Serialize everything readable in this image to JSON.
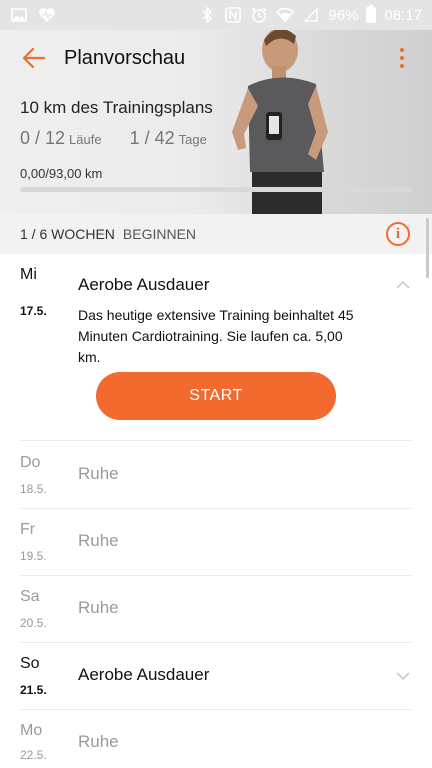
{
  "statusbar": {
    "battery_percent": "96%",
    "time": "08:17",
    "icons": [
      "image-icon",
      "heart-monitor-icon",
      "bluetooth-icon",
      "nfc-icon",
      "alarm-icon",
      "wifi-icon",
      "signal-icon",
      "battery-icon"
    ]
  },
  "header": {
    "title": "Planvorschau",
    "plan_name": "10 km des Trainingsplans",
    "runs_value": "0 / 12",
    "runs_unit": "Läufe",
    "days_value": "1 / 42",
    "days_unit": "Tage",
    "distance": "0,00/93,00 km",
    "progress_fraction": 0.0
  },
  "weekbar": {
    "weeks": "1 / 6 WOCHEN",
    "begin_label": "BEGINNEN"
  },
  "days": [
    {
      "day": "Mi",
      "date": "17.5.",
      "title": "Aerobe Ausdauer",
      "state": "active-expanded",
      "description": "Das heutige extensive Training beinhaltet 45 Minuten Cardiotraining. Sie laufen ca. 5,00 km.",
      "button": "START"
    },
    {
      "day": "Do",
      "date": "18.5.",
      "title": "Ruhe",
      "state": "rest"
    },
    {
      "day": "Fr",
      "date": "19.5.",
      "title": "Ruhe",
      "state": "rest"
    },
    {
      "day": "Sa",
      "date": "20.5.",
      "title": "Ruhe",
      "state": "rest"
    },
    {
      "day": "So",
      "date": "21.5.",
      "title": "Aerobe Ausdauer",
      "state": "active-collapsed"
    },
    {
      "day": "Mo",
      "date": "22.5.",
      "title": "Ruhe",
      "state": "rest"
    }
  ],
  "colors": {
    "accent": "#f26a2e",
    "rest_text": "#9a9a9a"
  }
}
